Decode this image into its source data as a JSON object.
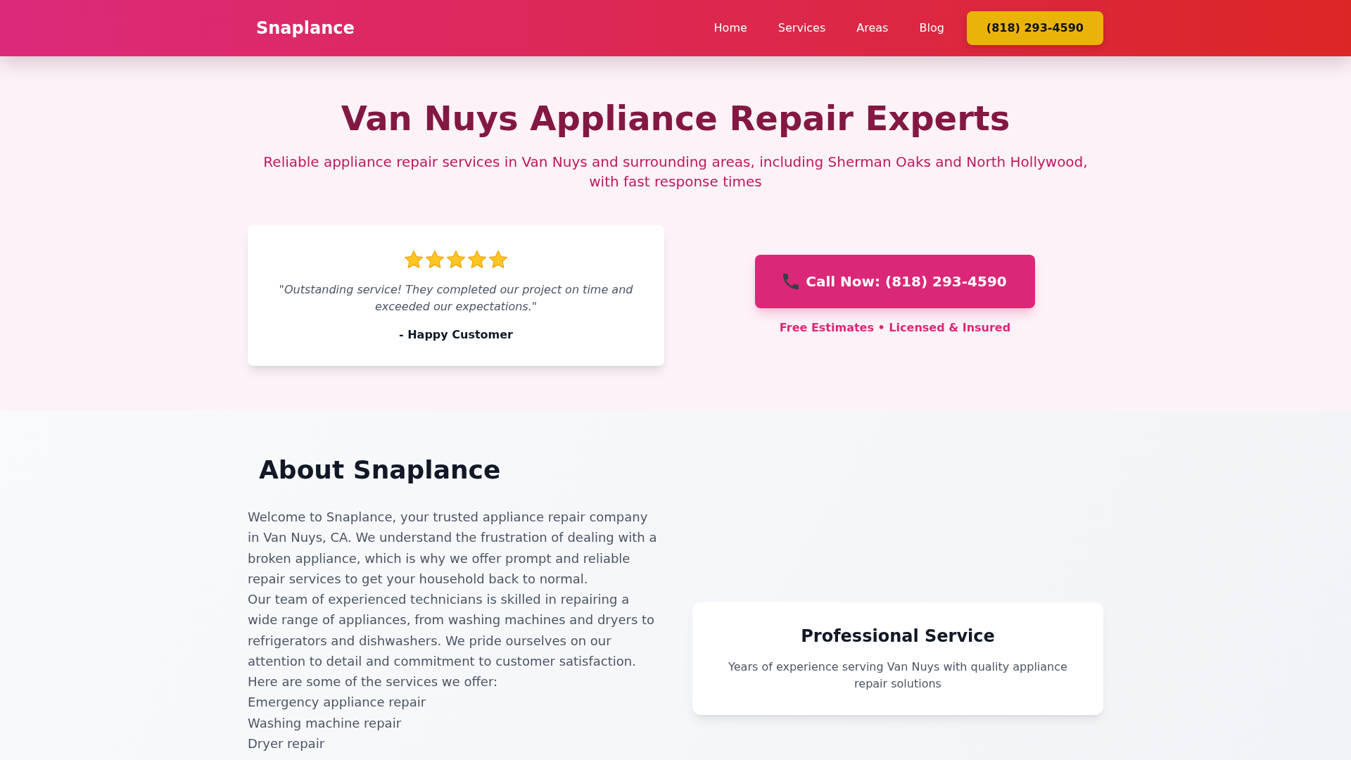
{
  "header": {
    "logo": "Snaplance",
    "nav": [
      "Home",
      "Services",
      "Areas",
      "Blog"
    ],
    "phone_button": "(818) 293-4590"
  },
  "hero": {
    "title": "Van Nuys Appliance Repair Experts",
    "subtitle": "Reliable appliance repair services in Van Nuys and surrounding areas, including Sherman Oaks and North Hollywood, with fast response times",
    "review": {
      "stars": 5,
      "quote": "\"Outstanding service! They completed our project on time and exceeded our expectations.\"",
      "author": "- Happy Customer"
    },
    "cta": {
      "button": "Call Now: (818) 293-4590",
      "note": "Free Estimates • Licensed & Insured"
    }
  },
  "about": {
    "title": "About Snaplance",
    "paragraphs": [
      "Welcome to Snaplance, your trusted appliance repair company in Van Nuys, CA. We understand the frustration of dealing with a broken appliance, which is why we offer prompt and reliable repair services to get your household back to normal.",
      "Our team of experienced technicians is skilled in repairing a wide range of appliances, from washing machines and dryers to refrigerators and dishwashers. We pride ourselves on our attention to detail and commitment to customer satisfaction.",
      "Here are some of the services we offer:"
    ],
    "services": [
      "Emergency appliance repair",
      "Washing machine repair",
      "Dryer repair"
    ],
    "feature_card": {
      "title": "Professional Service",
      "text": "Years of experience serving Van Nuys with quality appliance repair solutions"
    }
  }
}
